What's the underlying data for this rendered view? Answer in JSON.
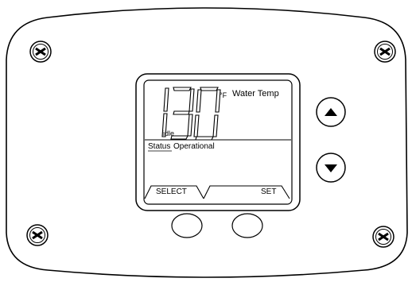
{
  "display": {
    "temperature": "130",
    "unit": "°F",
    "title": "Water Temp",
    "mode": "idle",
    "status_label": "Status",
    "status_value": "Operational"
  },
  "softkeys": {
    "left_label": "SELECT",
    "right_label": "SET"
  },
  "buttons": {
    "up_icon": "triangle-up-icon",
    "down_icon": "triangle-down-icon"
  },
  "screws": {
    "icon": "phillips-screw-icon"
  }
}
